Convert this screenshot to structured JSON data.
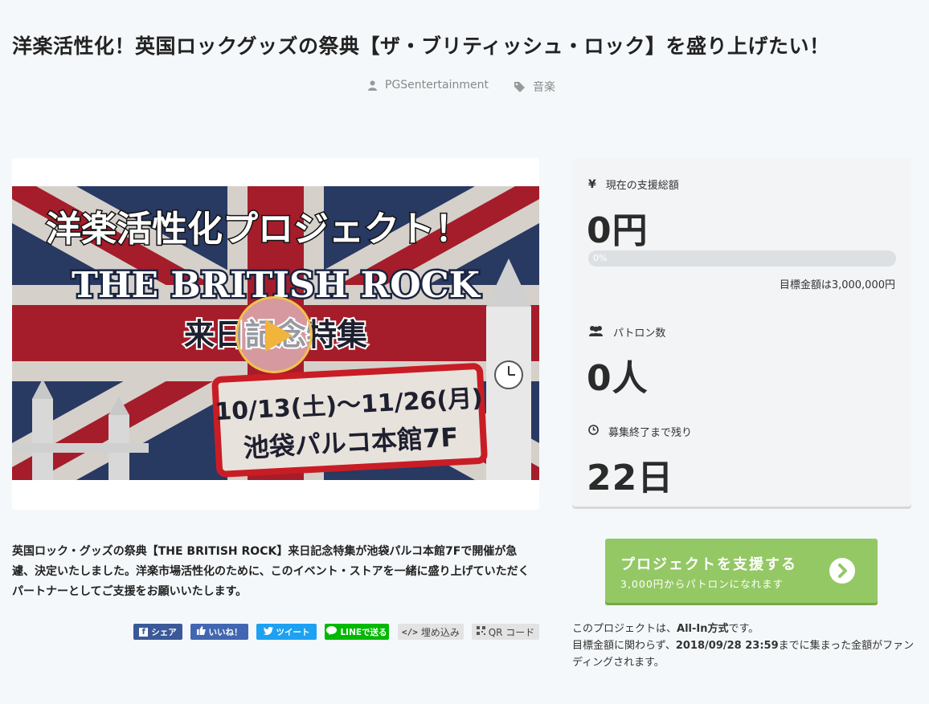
{
  "project": {
    "title": "洋楽活性化！英国ロックグッズの祭典【ザ・ブリティッシュ・ロック】を盛り上げたい！",
    "owner": "PGSentertainment",
    "category": "音楽",
    "description": "英国ロック・グッズの祭典【THE BRITISH ROCK】来日記念特集が池袋パルコ本館7Fで開催が急遽、決定いたしました。洋楽市場活性化のために、このイベント・ストアを一緒に盛り上げていただくパートナーとしてご支援をお願いいたします。"
  },
  "banner": {
    "line1": "洋楽活性化プロジェクト！",
    "line2": "THE BRITISH ROCK",
    "line3": "来日記念特集",
    "line4": "10/13(土)〜11/26(月)",
    "line5": "池袋パルコ本館7F"
  },
  "stats": {
    "total_label": "現在の支援総額",
    "total_value": "0円",
    "progress_percent": 0,
    "progress_text": "0%",
    "goal_text": "目標金額は3,000,000円",
    "patrons_label": "パトロン数",
    "patrons_value": "0人",
    "remaining_label": "募集終了まで残り",
    "remaining_value": "22日"
  },
  "support_button": {
    "main": "プロジェクトを支援する",
    "sub": "3,000円からパトロンになれます"
  },
  "share": {
    "facebook": "シェア",
    "like": "いいね！",
    "tweet": "ツイート",
    "line": "LINEで送る",
    "embed": "埋め込み",
    "qr": "QR コード"
  },
  "funding_note": {
    "line1_pre": "このプロジェクトは、",
    "line1_bold": "All-In方式",
    "line1_post": "です。",
    "line2_pre": "目標金額に関わらず、",
    "line2_bold": "2018/09/28 23:59",
    "line2_post": "までに集まった金額がファンディングされます。"
  },
  "colors": {
    "accent_green": "#94c865",
    "facebook": "#3b5998",
    "twitter": "#1da1f2",
    "line": "#00b900"
  }
}
